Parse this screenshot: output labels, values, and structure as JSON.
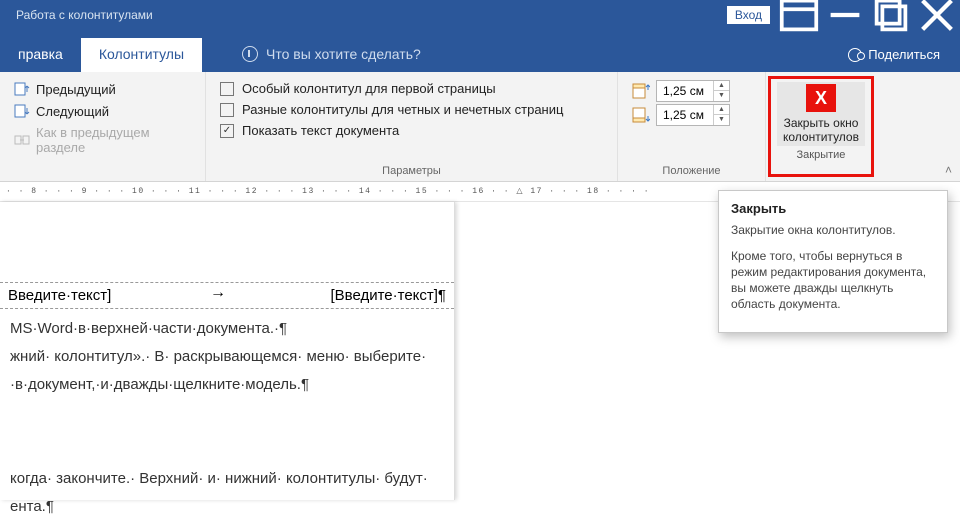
{
  "titlebar": {
    "context_title": "Работа с колонтитулами",
    "signin": "Вход"
  },
  "tabs": {
    "editing": "правка",
    "headers": "Колонтитулы",
    "tellme": "Что вы хотите сделать?",
    "share": "Поделиться"
  },
  "nav": {
    "previous": "Предыдущий",
    "next": "Следующий",
    "link_previous": "Как в предыдущем разделе"
  },
  "options": {
    "first_page": "Особый колонтитул для первой страницы",
    "odd_even": "Разные колонтитулы для четных и нечетных страниц",
    "show_doc": "Показать текст документа",
    "group": "Параметры"
  },
  "position": {
    "top": "1,25 см",
    "bottom": "1,25 см",
    "group": "Положение"
  },
  "close": {
    "line1": "Закрыть окно",
    "line2": "колонтитулов",
    "group": "Закрытие"
  },
  "tooltip": {
    "title": "Закрыть",
    "p1": "Закрытие окна колонтитулов.",
    "p2": "Кроме того, чтобы вернуться в режим редактирования документа, вы можете дважды щелкнуть область документа."
  },
  "doc": {
    "hdr_left": "Введите·текст]",
    "hdr_tab": "→",
    "hdr_right": "[Введите·текст]¶",
    "l1": "MS·Word·в·верхней·части·документа.·¶",
    "l2": "жний· колонтитул».· В· раскрывающемся· меню· выберите·",
    "l3": "·в·документ,·и·дважды·щелкните·модель.¶",
    "l4": "когда· закончите.· Верхний· и· нижний· колонтитулы· будут·",
    "l5": "ента.¶"
  },
  "ruler": "· · 8 · · · 9 · · · 10 · · · 11 · · · 12 · · · 13 · · · 14 · · · 15 · · · 16 · · △ 17 · · · 18 · · · ·"
}
